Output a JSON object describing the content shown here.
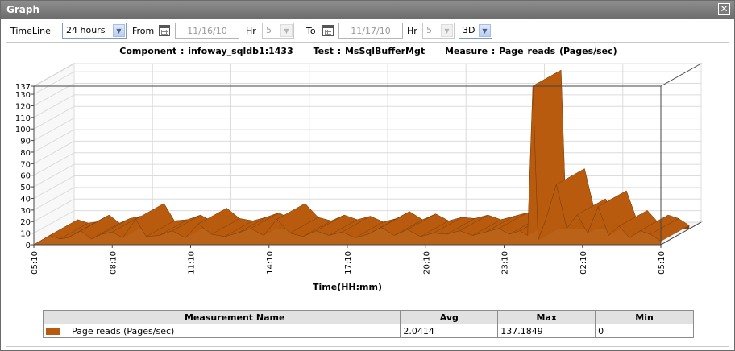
{
  "window": {
    "title": "Graph",
    "close_label": "✕"
  },
  "toolbar": {
    "timeline_label": "TimeLine",
    "timeline_value": "24 hours",
    "from_label": "From",
    "from_date": "11/16/10",
    "from_hr_label": "Hr",
    "from_hr_value": "5",
    "to_label": "To",
    "to_date": "11/17/10",
    "to_hr_label": "Hr",
    "to_hr_value": "5",
    "view_value": "3D"
  },
  "header": {
    "component": "Component : infoway_sqldb1:1433",
    "test": "Test : MsSqlBufferMgt",
    "measure": "Measure : Page reads  (Pages/sec)"
  },
  "colors": {
    "series": "#b85b0e",
    "series_dark": "#8a4208",
    "grid": "#dcdcdc"
  },
  "chart_data": {
    "type": "area",
    "xlabel": "Time(HH:mm)",
    "ylim": [
      0,
      137
    ],
    "y_ticks": [
      "0",
      "10",
      "20",
      "30",
      "40",
      "50",
      "60",
      "70",
      "80",
      "90",
      "100",
      "110",
      "120",
      "130",
      "137"
    ],
    "x_ticks": [
      "05:10",
      "08:10",
      "11:10",
      "14:10",
      "17:10",
      "20:10",
      "23:10",
      "02:10",
      "05:10"
    ],
    "x_hours": [
      0,
      3,
      6,
      9,
      12,
      15,
      18,
      21,
      24
    ],
    "series": [
      {
        "name": "Page reads (Pages/sec)",
        "x_hours": [
          0,
          0.6,
          1.0,
          1.3,
          1.8,
          2.2,
          2.6,
          3.0,
          3.4,
          3.9,
          4.3,
          4.8,
          5.3,
          5.8,
          6.3,
          6.8,
          7.3,
          7.8,
          8.3,
          8.8,
          9.3,
          9.8,
          10.3,
          10.8,
          11.3,
          11.8,
          12.3,
          12.8,
          13.3,
          13.8,
          14.3,
          14.8,
          15.3,
          15.8,
          16.3,
          16.8,
          17.3,
          17.8,
          18.2,
          18.6,
          18.9,
          19.1,
          19.3,
          19.6,
          20.0,
          20.4,
          20.8,
          21.2,
          21.6,
          22.0,
          22.4,
          22.8,
          23.2,
          23.6,
          24.0
        ],
        "values": [
          0,
          8,
          5,
          6,
          12,
          5,
          9,
          11,
          6,
          22,
          7,
          8,
          12,
          6,
          18,
          9,
          7,
          10,
          14,
          8,
          22,
          10,
          7,
          12,
          8,
          11,
          6,
          9,
          15,
          8,
          13,
          7,
          10,
          9,
          12,
          8,
          11,
          14,
          9,
          12,
          8,
          137.18,
          4,
          22,
          52,
          14,
          26,
          10,
          33,
          8,
          16,
          6,
          12,
          9,
          3
        ]
      }
    ]
  },
  "table": {
    "headers": [
      "",
      "Measurement Name",
      "Avg",
      "Max",
      "Min"
    ],
    "rows": [
      {
        "name": "Page reads (Pages/sec)",
        "avg": "2.0414",
        "max": "137.1849",
        "min": "0"
      }
    ]
  }
}
